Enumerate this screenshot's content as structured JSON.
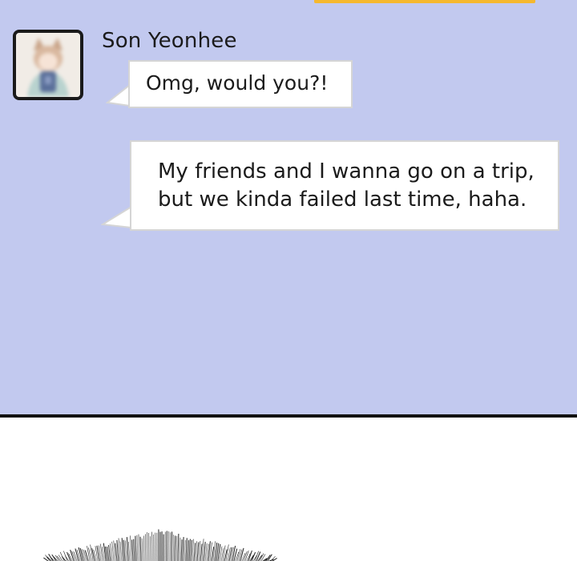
{
  "chat": {
    "sender": "Son Yeonhee",
    "messages": [
      {
        "text": "Omg, would you?!"
      },
      {
        "text": "My friends and I wanna go on a trip,\nbut we kinda failed last time, haha."
      }
    ]
  },
  "colors": {
    "panel_bg": "#c2c9ef",
    "bubble_bg": "#ffffff",
    "bubble_border": "#d5d5d5",
    "panel_border": "#111111",
    "top_strip": "#f5b82e"
  }
}
